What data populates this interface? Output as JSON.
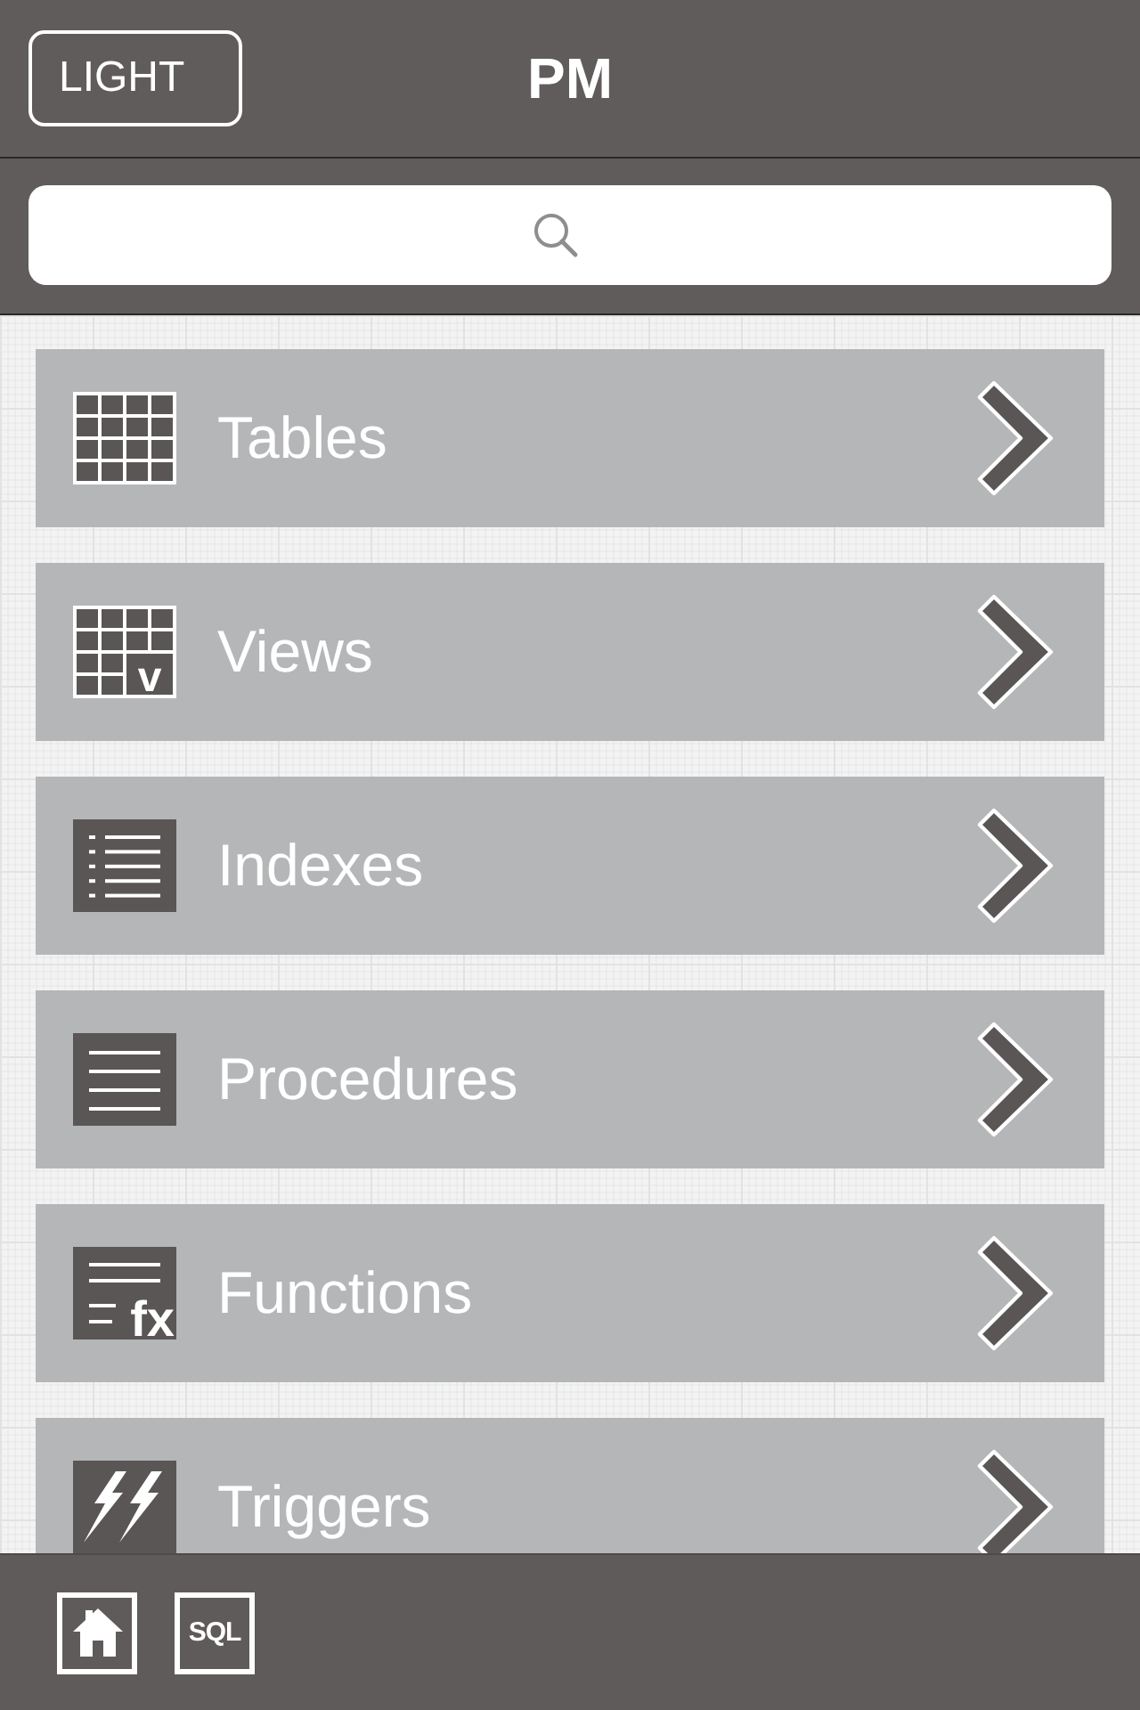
{
  "header": {
    "button": "LIGHT",
    "title": "PM"
  },
  "items": [
    {
      "kind": "tables",
      "label": "Tables"
    },
    {
      "kind": "views",
      "label": "Views",
      "icon_text": "v"
    },
    {
      "kind": "indexes",
      "label": "Indexes"
    },
    {
      "kind": "procedures",
      "label": "Procedures"
    },
    {
      "kind": "functions",
      "label": "Functions",
      "icon_text": "fx"
    },
    {
      "kind": "triggers",
      "label": "Triggers"
    }
  ],
  "toolbar": [
    {
      "kind": "home"
    },
    {
      "kind": "sql",
      "label": "SQL"
    }
  ]
}
